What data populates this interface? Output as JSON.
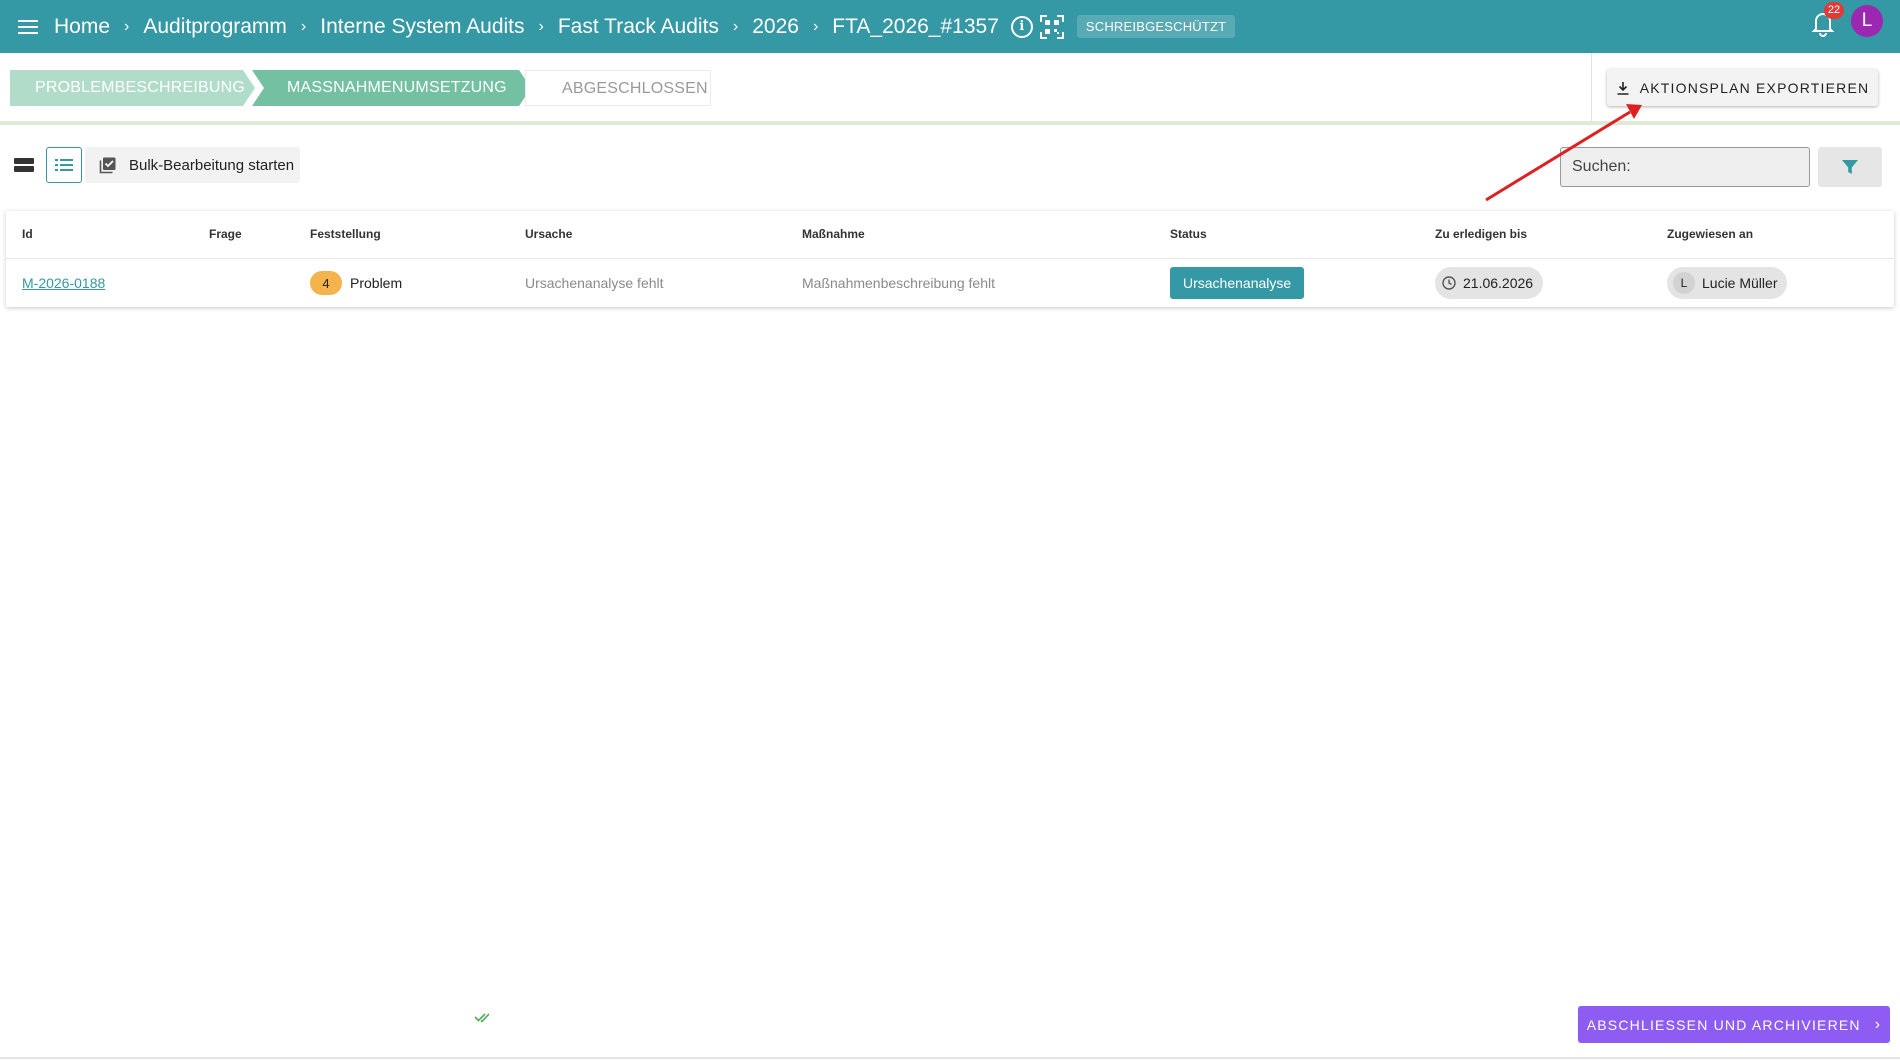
{
  "breadcrumbs": [
    "Home",
    "Auditprogramm",
    "Interne System Audits",
    "Fast Track Audits",
    "2026",
    "FTA_2026_#1357"
  ],
  "readonly_badge": "SCHREIBGESCHÜTZT",
  "notifications": {
    "count": "22"
  },
  "user": {
    "initial": "L"
  },
  "stepper": {
    "steps": [
      "PROBLEMBESCHREIBUNG",
      "MASSNAHMENUMSETZUNG",
      "ABGESCHLOSSEN"
    ]
  },
  "export_label": "AKTIONSPLAN EXPORTIEREN",
  "toolbar": {
    "bulk_label": "Bulk-Bearbeitung starten",
    "search_placeholder": "Suchen:"
  },
  "table": {
    "columns": [
      "Id",
      "Frage",
      "Feststellung",
      "Ursache",
      "Maßnahme",
      "Status",
      "Zu erledigen bis",
      "Zugewiesen an"
    ],
    "rows": [
      {
        "id": "M-2026-0188",
        "frage": "",
        "severity": "4",
        "feststellung": "Problem",
        "ursache": "Ursachenanalyse fehlt",
        "massnahme": "Maßnahmenbeschreibung fehlt",
        "status": "Ursachenanalyse",
        "due": "21.06.2026",
        "assignee_initial": "L",
        "assignee": "Lucie Müller"
      }
    ]
  },
  "footer": {
    "finish_label": "ABSCHLIESSEN UND ARCHIVIEREN"
  },
  "colors": {
    "primary": "#3498a5",
    "accent": "#8e5cf2",
    "severity": "#f4b34c",
    "annotation": "#e02020"
  },
  "icons": [
    "menu-icon",
    "chevron-right-icon",
    "info-icon",
    "qr-code-icon",
    "bell-icon",
    "download-icon",
    "view-cards-icon",
    "view-list-icon",
    "checkbox-icon",
    "filter-icon",
    "clock-icon",
    "double-check-icon"
  ]
}
